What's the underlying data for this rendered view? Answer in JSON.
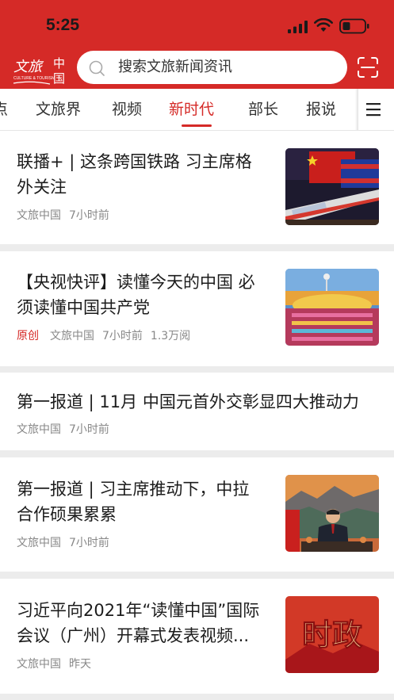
{
  "status_bar": {
    "time": "5:25"
  },
  "header": {
    "logo_text": "文旅中国",
    "logo_sub": "CULTURE & TOURISM",
    "search_placeholder": "搜索文旅新闻资讯"
  },
  "tabs": [
    "点",
    "文旅界",
    "视频",
    "新时代",
    "部长",
    "报说"
  ],
  "active_tab": "新时代",
  "articles": [
    {
      "title_lines": [
        "联播+ | 这条跨国铁路 习主席格",
        "外关注"
      ],
      "original": "",
      "source": "文旅中国",
      "time": "7小时前",
      "views": "",
      "thumb": "railway-train-flags"
    },
    {
      "title_lines": [
        "【央视快评】读懂今天的中国 必",
        "须读懂中国共产党"
      ],
      "original": "原创",
      "source": "文旅中国",
      "time": "7小时前",
      "views": "1.3万阅",
      "thumb": "celebration-square"
    },
    {
      "title_lines": [
        "第一报道 | 11月 中国元首外交彰显四大推动力"
      ],
      "original": "",
      "source": "文旅中国",
      "time": "7小时前",
      "views": "",
      "thumb": ""
    },
    {
      "title_lines": [
        "第一报道 | 习主席推动下，中拉",
        "合作硕果累累"
      ],
      "original": "",
      "source": "文旅中国",
      "time": "7小时前",
      "views": "",
      "thumb": "speaker-at-desk"
    },
    {
      "title_lines": [
        "习近平向2021年“读懂中国”国际",
        "会议（广州）开幕式发表视频..."
      ],
      "original": "",
      "source": "文旅中国",
      "time": "昨天",
      "views": "",
      "thumb": "shizheng-banner",
      "thumb_text": "时政"
    }
  ],
  "colors": {
    "brand_red": "#d52a27",
    "meta_gray": "#888888",
    "divider": "#ececec"
  }
}
